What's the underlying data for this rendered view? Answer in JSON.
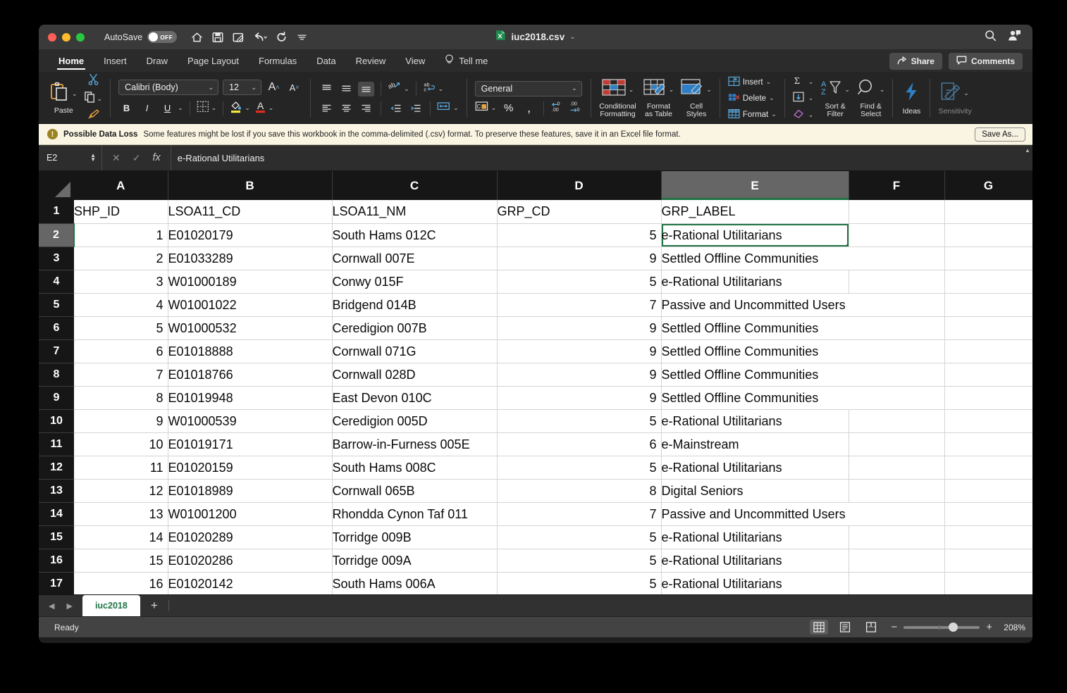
{
  "titlebar": {
    "autosave_label": "AutoSave",
    "autosave_state": "OFF",
    "document_name": "iuc2018.csv",
    "qat": [
      "home-icon",
      "save-icon",
      "quick-print-icon",
      "undo-icon",
      "redo-icon",
      "customize-icon"
    ],
    "right_icons": [
      "search-icon",
      "account-icon"
    ]
  },
  "ribbon_tabs": {
    "items": [
      {
        "label": "Home",
        "active": true
      },
      {
        "label": "Insert",
        "active": false
      },
      {
        "label": "Draw",
        "active": false
      },
      {
        "label": "Page Layout",
        "active": false
      },
      {
        "label": "Formulas",
        "active": false
      },
      {
        "label": "Data",
        "active": false
      },
      {
        "label": "Review",
        "active": false
      },
      {
        "label": "View",
        "active": false
      }
    ],
    "tell_me": "Tell me",
    "share": "Share",
    "comments": "Comments"
  },
  "ribbon": {
    "paste_label": "Paste",
    "font_name": "Calibri (Body)",
    "font_size": "12",
    "number_format": "General",
    "conditional_formatting": "Conditional\nFormatting",
    "conditional_formatting_l1": "Conditional",
    "conditional_formatting_l2": "Formatting",
    "format_as_table_l1": "Format",
    "format_as_table_l2": "as Table",
    "cell_styles_l1": "Cell",
    "cell_styles_l2": "Styles",
    "insert_label": "Insert",
    "delete_label": "Delete",
    "format_label": "Format",
    "sort_filter_l1": "Sort &",
    "sort_filter_l2": "Filter",
    "find_select_l1": "Find &",
    "find_select_l2": "Select",
    "ideas_label": "Ideas",
    "sensitivity_label": "Sensitivity",
    "bold": "B",
    "italic": "I",
    "underline": "U",
    "percent": "%",
    "comma": ","
  },
  "warning": {
    "title": "Possible Data Loss",
    "message": "Some features might be lost if you save this workbook in the comma-delimited (.csv) format. To preserve these features, save it in an Excel file format.",
    "button": "Save As..."
  },
  "formula_bar": {
    "name_box": "E2",
    "cancel_icon": "close-icon",
    "accept_icon": "check-icon",
    "function_icon": "fx",
    "content": "e-Rational Utilitarians"
  },
  "grid": {
    "columns": [
      "A",
      "B",
      "C",
      "D",
      "E",
      "F",
      "G"
    ],
    "selected_column": "E",
    "selected_row": 2,
    "selected_cell": "E2",
    "rows": [
      {
        "n": "1",
        "A": "SHP_ID",
        "B": "LSOA11_CD",
        "C": "LSOA11_NM",
        "D": "GRP_CD",
        "E": "GRP_LABEL"
      },
      {
        "n": "2",
        "A": "1",
        "B": "E01020179",
        "C": "South Hams 012C",
        "D": "5",
        "E": "e-Rational Utilitarians"
      },
      {
        "n": "3",
        "A": "2",
        "B": "E01033289",
        "C": "Cornwall 007E",
        "D": "9",
        "E": "Settled Offline Communities"
      },
      {
        "n": "4",
        "A": "3",
        "B": "W01000189",
        "C": "Conwy 015F",
        "D": "5",
        "E": "e-Rational Utilitarians"
      },
      {
        "n": "5",
        "A": "4",
        "B": "W01001022",
        "C": "Bridgend 014B",
        "D": "7",
        "E": "Passive and Uncommitted Users"
      },
      {
        "n": "6",
        "A": "5",
        "B": "W01000532",
        "C": "Ceredigion 007B",
        "D": "9",
        "E": "Settled Offline Communities"
      },
      {
        "n": "7",
        "A": "6",
        "B": "E01018888",
        "C": "Cornwall 071G",
        "D": "9",
        "E": "Settled Offline Communities"
      },
      {
        "n": "8",
        "A": "7",
        "B": "E01018766",
        "C": "Cornwall 028D",
        "D": "9",
        "E": "Settled Offline Communities"
      },
      {
        "n": "9",
        "A": "8",
        "B": "E01019948",
        "C": "East Devon 010C",
        "D": "9",
        "E": "Settled Offline Communities"
      },
      {
        "n": "10",
        "A": "9",
        "B": "W01000539",
        "C": "Ceredigion 005D",
        "D": "5",
        "E": "e-Rational Utilitarians"
      },
      {
        "n": "11",
        "A": "10",
        "B": "E01019171",
        "C": "Barrow-in-Furness 005E",
        "D": "6",
        "E": "e-Mainstream"
      },
      {
        "n": "12",
        "A": "11",
        "B": "E01020159",
        "C": "South Hams 008C",
        "D": "5",
        "E": "e-Rational Utilitarians"
      },
      {
        "n": "13",
        "A": "12",
        "B": "E01018989",
        "C": "Cornwall 065B",
        "D": "8",
        "E": "Digital Seniors"
      },
      {
        "n": "14",
        "A": "13",
        "B": "W01001200",
        "C": "Rhondda Cynon Taf 011",
        "D": "7",
        "E": "Passive and Uncommitted Users"
      },
      {
        "n": "15",
        "A": "14",
        "B": "E01020289",
        "C": "Torridge 009B",
        "D": "5",
        "E": "e-Rational Utilitarians"
      },
      {
        "n": "16",
        "A": "15",
        "B": "E01020286",
        "C": "Torridge 009A",
        "D": "5",
        "E": "e-Rational Utilitarians"
      },
      {
        "n": "17",
        "A": "16",
        "B": "E01020142",
        "C": "South Hams 006A",
        "D": "5",
        "E": "e-Rational Utilitarians"
      }
    ]
  },
  "sheet_tabs": {
    "prev_icon": "chevron-left-icon",
    "next_icon": "chevron-right-icon",
    "tabs": [
      {
        "label": "iuc2018",
        "active": true
      }
    ],
    "add_label": "+"
  },
  "status_bar": {
    "state": "Ready",
    "views": [
      "normal-view-icon",
      "page-layout-icon",
      "page-break-icon"
    ],
    "active_view": "normal-view-icon",
    "zoom_out": "−",
    "zoom_in": "+",
    "zoom_level": "208%"
  },
  "colors": {
    "accent_green": "#217346",
    "header_dark": "#161616",
    "warning_bg": "#faf5e3"
  }
}
